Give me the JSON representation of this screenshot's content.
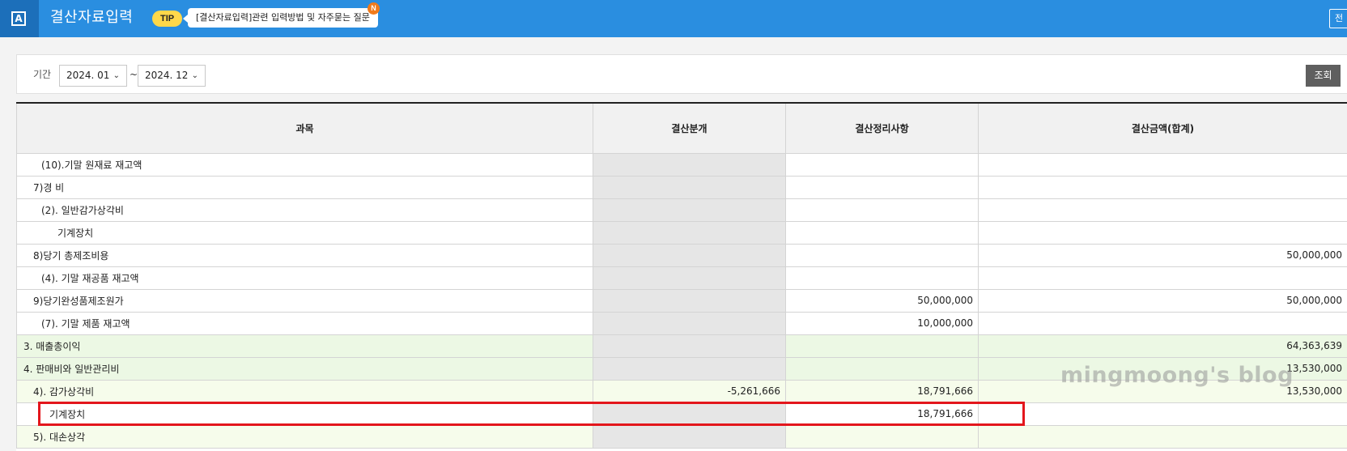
{
  "header": {
    "logo_letter": "A",
    "title": "결산자료입력",
    "tip_badge": "TIP",
    "tip_text": "[결산자료입력]관련 입력방법 및 자주묻는 질문",
    "new_badge": "N",
    "right_button": "전",
    "color": "#2a8ee0"
  },
  "filter": {
    "period_label": "기간",
    "from_value": "2024. 01",
    "separator": "~",
    "to_value": "2024. 12",
    "search_button": "조회"
  },
  "table": {
    "columns": [
      "과목",
      "결산분개",
      "결산정리사항",
      "결산금액(합계)"
    ],
    "rows": [
      {
        "label": "(10).기말 원재료 재고액",
        "entry": "",
        "adjust": "",
        "total": ""
      },
      {
        "label": "7)경  비",
        "entry": "",
        "adjust": "",
        "total": ""
      },
      {
        "label": "(2). 일반감가상각비",
        "entry": "",
        "adjust": "",
        "total": ""
      },
      {
        "label": "기계장치",
        "entry": "",
        "adjust": "",
        "total": ""
      },
      {
        "label": "8)당기 총제조비용",
        "entry": "",
        "adjust": "",
        "total": "50,000,000"
      },
      {
        "label": "(4). 기말 재공품 재고액",
        "entry": "",
        "adjust": "",
        "total": ""
      },
      {
        "label": "9)당기완성품제조원가",
        "entry": "",
        "adjust": "50,000,000",
        "total": "50,000,000"
      },
      {
        "label": "(7). 기말 제품 재고액",
        "entry": "",
        "adjust": "10,000,000",
        "total": ""
      },
      {
        "label": "3. 매출총이익",
        "entry": "",
        "adjust": "",
        "total": "64,363,639"
      },
      {
        "label": "4. 판매비와 일반관리비",
        "entry": "",
        "adjust": "",
        "total": "13,530,000"
      },
      {
        "label": "4). 감가상각비",
        "entry": "-5,261,666",
        "adjust": "18,791,666",
        "total": "13,530,000"
      },
      {
        "label": "기계장치",
        "entry": "",
        "adjust": "18,791,666",
        "total": ""
      },
      {
        "label": "5). 대손상각",
        "entry": "",
        "adjust": "",
        "total": ""
      }
    ]
  },
  "watermark": "mingmoong's blog",
  "colors": {
    "header_blue": "#2a8ee0",
    "highlight_red": "#e3161c",
    "green_row": "#ecf8e4",
    "light_green_row": "#f6fceb"
  }
}
